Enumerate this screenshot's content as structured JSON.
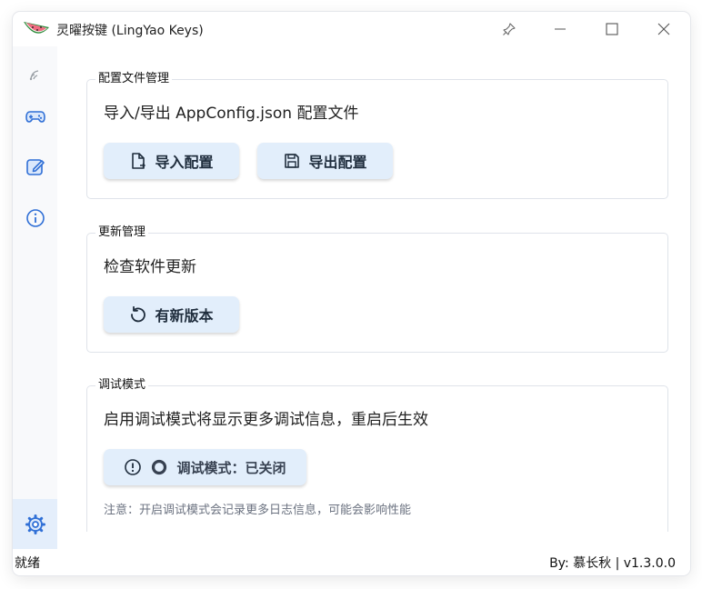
{
  "window": {
    "title": "灵曜按键 (LingYao Keys)",
    "controls": [
      "pin-icon",
      "minimize-icon",
      "maximize-icon",
      "close-icon"
    ]
  },
  "sidebar": {
    "items": [
      {
        "icon": "signal-icon",
        "active": false
      },
      {
        "icon": "gamepad-icon",
        "active": false
      },
      {
        "icon": "edit-icon",
        "active": false
      },
      {
        "icon": "info-icon",
        "active": false
      }
    ],
    "footer": {
      "icon": "gear-icon",
      "active": true
    }
  },
  "config": {
    "legend": "配置文件管理",
    "desc": "导入/导出 AppConfig.json 配置文件",
    "import_label": "导入配置",
    "export_label": "导出配置"
  },
  "update": {
    "legend": "更新管理",
    "desc": "检查软件更新",
    "button_label": "有新版本"
  },
  "debug": {
    "legend": "调试模式",
    "desc": "启用调试模式将显示更多调试信息，重启后生效",
    "button_label": "调试模式：已关闭",
    "note": "注意：开启调试模式会记录更多日志信息，可能会影响性能"
  },
  "status": {
    "left": "就绪",
    "right": "By: 慕长秋 | v1.3.0.0"
  },
  "colors": {
    "accent": "#2f6fd6",
    "button_bg": "#e2eefb",
    "sidebar_active": "#e4eefb"
  }
}
